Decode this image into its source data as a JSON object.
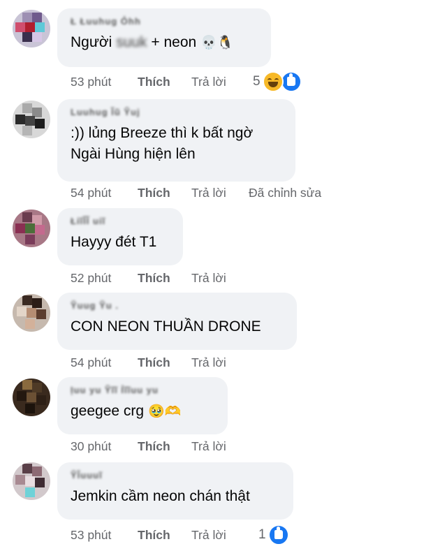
{
  "actions": {
    "like_label": "Thích",
    "reply_label": "Trả lời"
  },
  "comments": [
    {
      "name": "Ł Łuuhug Ỏhh",
      "text_prefix": "Người",
      "text_blurred": "suuk",
      "text_suffix": "+ neon",
      "emojis": "💀🐧",
      "time": "53 phút",
      "reactions": {
        "count": "5",
        "types": [
          "haha-icon",
          "like-icon"
        ]
      }
    },
    {
      "name": "Luuhug Ĩũ Ỹuj",
      "lines": [
        ":)) lủng Breeze thì k bất ngờ",
        "Ngài Hùng hiện lên"
      ],
      "time": "54 phút",
      "edited": "Đã chỉnh sửa"
    },
    {
      "name": "ŁiĩĨĨ uiĩ",
      "text": "Hayyy đét T1",
      "time": "52 phút"
    },
    {
      "name": "Ỹuug Ỹu .",
      "text": "CON NEON THUẦN DRONE",
      "time": "54 phút"
    },
    {
      "name": "Ịuu yu Ỹĩĩ Ỉĩĩuu yu",
      "text": "geegee crg",
      "emojis": "🥹🫶",
      "time": "30 phút"
    },
    {
      "name": "ỸĨuuuĩ",
      "text": "Jemkin cầm neon chán thật",
      "time": "53 phút",
      "reactions": {
        "count": "1",
        "types": [
          "like-icon"
        ]
      }
    }
  ],
  "colors": {
    "bubble": "#f0f2f5",
    "meta": "#65676b",
    "like_blue": "#1877f2",
    "haha_yellow": "#f7b928"
  }
}
